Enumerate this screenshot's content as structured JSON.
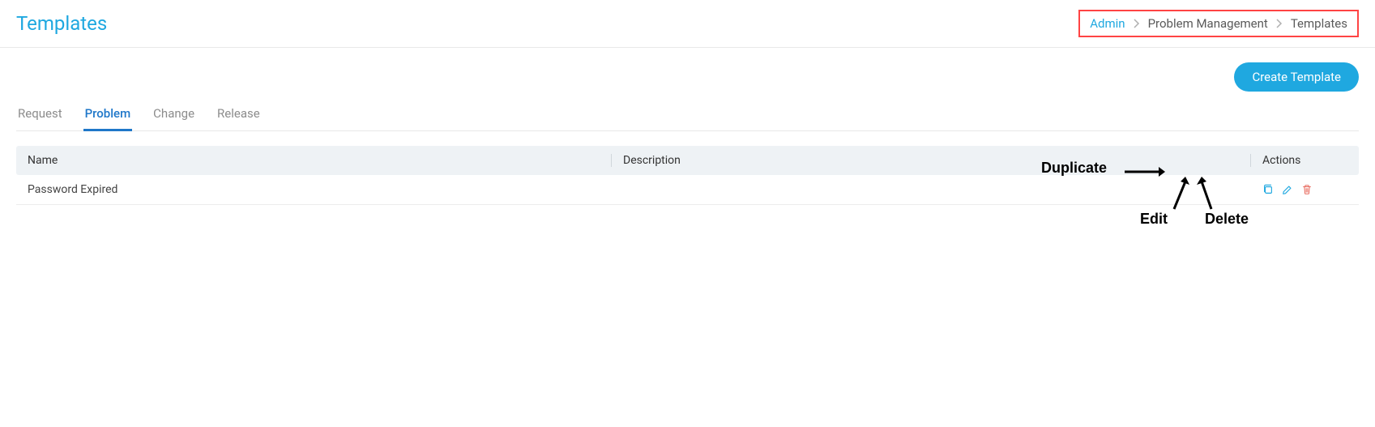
{
  "header": {
    "title": "Templates"
  },
  "breadcrumb": {
    "admin": "Admin",
    "pm": "Problem Management",
    "templates": "Templates"
  },
  "toolbar": {
    "create_template": "Create Template"
  },
  "tabs": {
    "request": "Request",
    "problem": "Problem",
    "change": "Change",
    "release": "Release"
  },
  "columns": {
    "name": "Name",
    "description": "Description",
    "actions": "Actions"
  },
  "rows": [
    {
      "name": "Password Expired",
      "description": ""
    }
  ],
  "annotations": {
    "duplicate": "Duplicate",
    "edit": "Edit",
    "delete": "Delete"
  }
}
